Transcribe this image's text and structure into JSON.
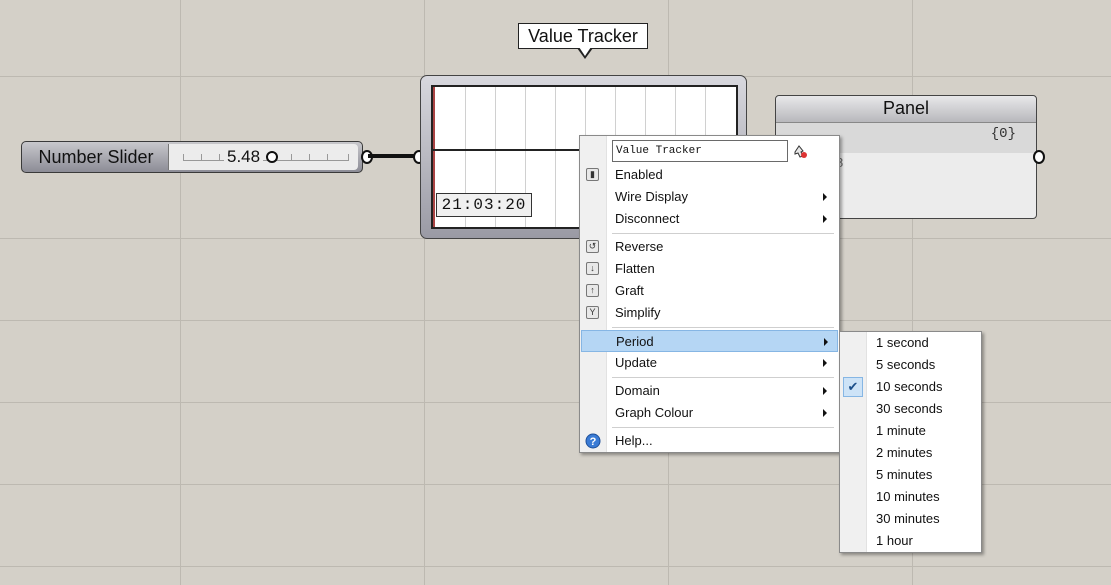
{
  "tooltip": {
    "title": "Value Tracker"
  },
  "slider": {
    "label": "Number Slider",
    "value": "5.48"
  },
  "tracker": {
    "time": "21:03:20"
  },
  "panel": {
    "title": "Panel",
    "path": "{0}",
    "index": "8"
  },
  "context_menu": {
    "name_value": "Value Tracker",
    "items": [
      {
        "label": "Enabled",
        "icon": "enabled-icon",
        "submenu": false
      },
      {
        "label": "Wire Display",
        "submenu": true
      },
      {
        "label": "Disconnect",
        "submenu": true
      },
      {
        "label": "Reverse",
        "icon": "reverse-icon",
        "submenu": false
      },
      {
        "label": "Flatten",
        "icon": "flatten-icon",
        "submenu": false
      },
      {
        "label": "Graft",
        "icon": "graft-icon",
        "submenu": false
      },
      {
        "label": "Simplify",
        "icon": "simplify-icon",
        "submenu": false
      },
      {
        "label": "Period",
        "submenu": true,
        "highlighted": true
      },
      {
        "label": "Update",
        "submenu": true
      },
      {
        "label": "Domain",
        "submenu": true
      },
      {
        "label": "Graph Colour",
        "submenu": true
      },
      {
        "label": "Help...",
        "icon": "help-icon",
        "submenu": false
      }
    ]
  },
  "period_submenu": {
    "items": [
      {
        "label": "1 second"
      },
      {
        "label": "5 seconds"
      },
      {
        "label": "10 seconds",
        "checked": true
      },
      {
        "label": "30 seconds"
      },
      {
        "label": "1 minute"
      },
      {
        "label": "2 minutes"
      },
      {
        "label": "5 minutes"
      },
      {
        "label": "10 minutes"
      },
      {
        "label": "30 minutes"
      },
      {
        "label": "1 hour"
      }
    ]
  },
  "colors": {
    "canvas": "#d4d0c8",
    "highlight": "#b5d6f4",
    "check": "#cde3f7"
  }
}
